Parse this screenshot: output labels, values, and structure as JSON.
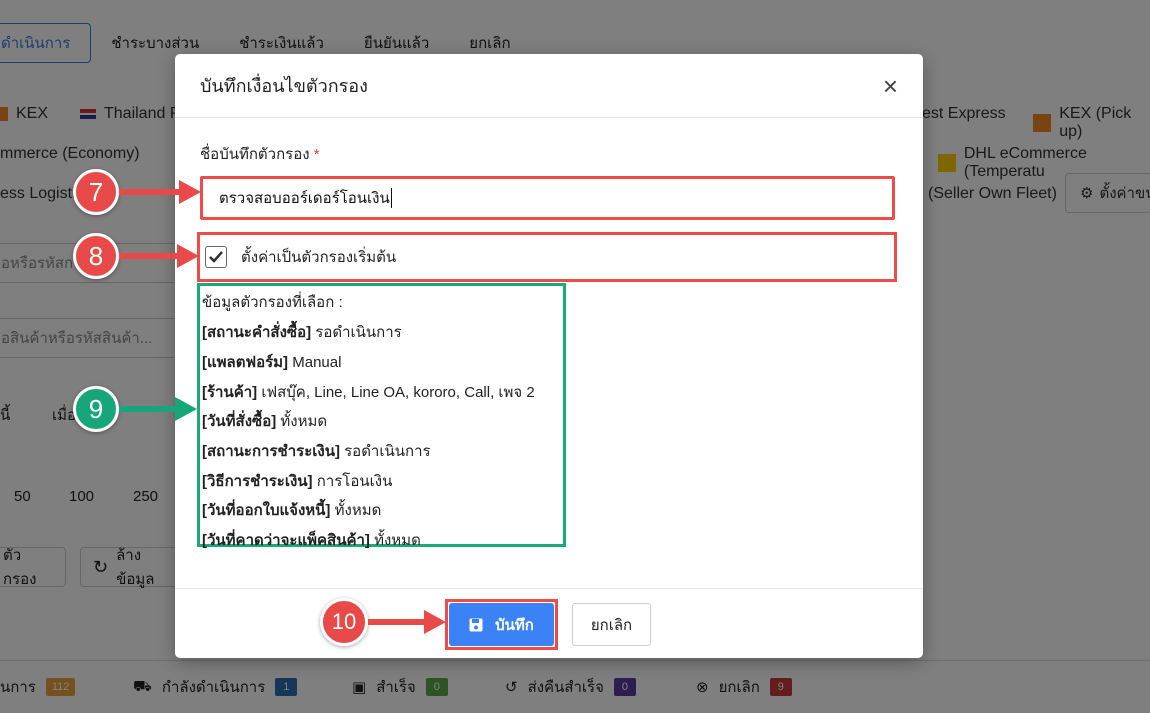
{
  "background": {
    "tabs": [
      "ดำเนินการ",
      "ชำระบางส่วน",
      "ชำระเงินแล้ว",
      "ยืนยันแล้ว",
      "ยกเลิก"
    ],
    "carriers_row1": [
      "KEX",
      "Thailand Po",
      "est Express",
      "KEX (Pick up)"
    ],
    "carriers_row2": [
      "mmerce (Economy)",
      "DHL eCommerce (Temperatu"
    ],
    "carriers_row3": [
      "ess Logistics",
      "(Seller Own Fleet)"
    ],
    "settings_button": "ตั้งค่าขน",
    "search_placeholder_1": "อหรือรหัสก",
    "search_placeholder_2": "อสินค้าหรือรหัสสินค้า...",
    "col_today": "นี้",
    "col_when": "เมื่อ",
    "page_sizes": [
      "50",
      "100",
      "250"
    ],
    "filter_button": "ตัวกรอง",
    "clear_button": "ล้างข้อมูล",
    "status_items": [
      {
        "label": "นการ",
        "count": "112",
        "color": "#e8a33d"
      },
      {
        "label": "กำลังดำเนินการ",
        "count": "1",
        "color": "#2f6fb3"
      },
      {
        "label": "สำเร็จ",
        "count": "0",
        "color": "#5aa84b"
      },
      {
        "label": "ส่งคืนสำเร็จ",
        "count": "0",
        "color": "#5a3d9e"
      },
      {
        "label": "ยกเลิก",
        "count": "9",
        "color": "#c73b3b"
      }
    ]
  },
  "modal": {
    "title": "บันทึกเงื่อนไขตัวกรอง",
    "field_label": "ชื่อบันทึกตัวกรอง",
    "required_mark": "*",
    "field_value": "ตรวจสอบออร์เดอร์โอนเงิน",
    "checkbox_label": "ตั้งค่าเป็นตัวกรองเริ่มต้น",
    "checkbox_checked": true,
    "info_heading": "ข้อมูลตัวกรองที่เลือก :",
    "info_items": [
      {
        "key": "[สถานะคำสั่งซื้อ]",
        "value": "รอดำเนินการ"
      },
      {
        "key": "[แพลตฟอร์ม]",
        "value": "Manual"
      },
      {
        "key": "[ร้านค้า]",
        "value": "เฟสบุ๊ค, Line, Line OA, kororo, Call, เพจ 2"
      },
      {
        "key": "[วันที่สั่งซื้อ]",
        "value": "ทั้งหมด"
      },
      {
        "key": "[สถานะการชำระเงิน]",
        "value": "รอดำเนินการ"
      },
      {
        "key": "[วิธีการชำระเงิน]",
        "value": "การโอนเงิน"
      },
      {
        "key": "[วันที่ออกใบแจ้งหนี้]",
        "value": "ทั้งหมด"
      },
      {
        "key": "[วันที่คาดว่าจะแพ็คสินค้า]",
        "value": "ทั้งหมด"
      }
    ],
    "save_label": "บันทึก",
    "cancel_label": "ยกเลิก"
  },
  "annotations": {
    "step7": "7",
    "step8": "8",
    "step9": "9",
    "step10": "10"
  }
}
